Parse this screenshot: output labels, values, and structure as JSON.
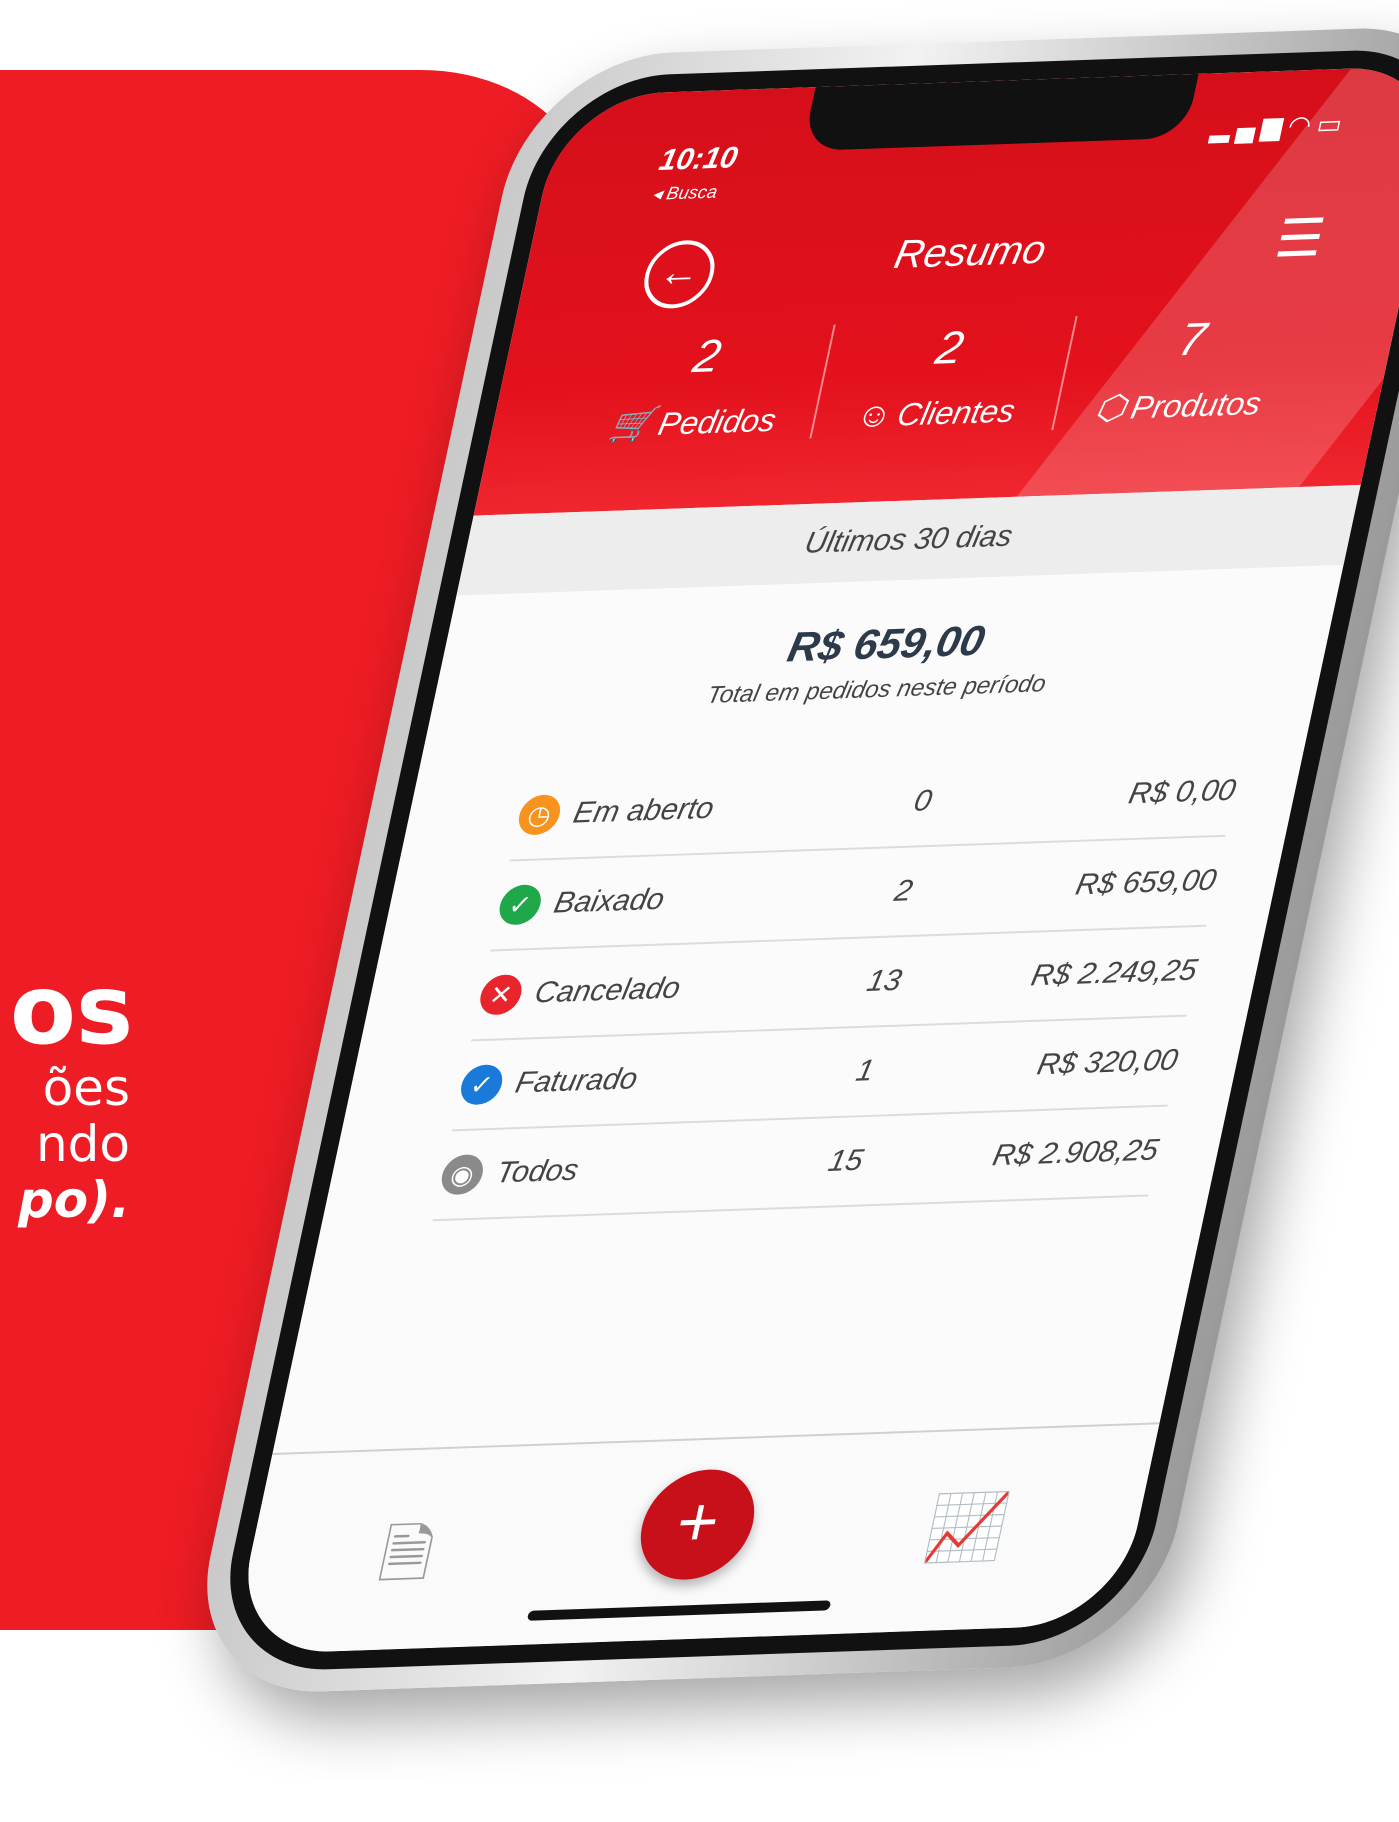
{
  "promo": {
    "headline": "os",
    "line1": "ões",
    "line2": "ndo",
    "line3": "po)."
  },
  "status_bar": {
    "time": "10:10",
    "back_label": "◂ Busca"
  },
  "header": {
    "title": "Resumo"
  },
  "stats": [
    {
      "value": "2",
      "label": "Pedidos",
      "icon": "basket-icon"
    },
    {
      "value": "2",
      "label": "Clientes",
      "icon": "user-icon"
    },
    {
      "value": "7",
      "label": "Produtos",
      "icon": "box-icon"
    }
  ],
  "period": "Últimos 30 dias",
  "total": {
    "amount": "R$ 659,00",
    "caption": "Total em pedidos neste período"
  },
  "rows": [
    {
      "name": "Em aberto",
      "count": "0",
      "value": "R$ 0,00",
      "color": "#f7931e",
      "icon": "clock-icon"
    },
    {
      "name": "Baixado",
      "count": "2",
      "value": "R$ 659,00",
      "color": "#1fa84a",
      "icon": "check-icon"
    },
    {
      "name": "Cancelado",
      "count": "13",
      "value": "R$ 2.249,25",
      "color": "#e8242c",
      "icon": "close-icon"
    },
    {
      "name": "Faturado",
      "count": "1",
      "value": "R$ 320,00",
      "color": "#1a7ad9",
      "icon": "check-icon"
    },
    {
      "name": "Todos",
      "count": "15",
      "value": "R$ 2.908,25",
      "color": "#8a8a8a",
      "icon": "basket-icon"
    }
  ],
  "colors": {
    "brand_red": "#e3111c",
    "dark_red": "#c8101a"
  }
}
